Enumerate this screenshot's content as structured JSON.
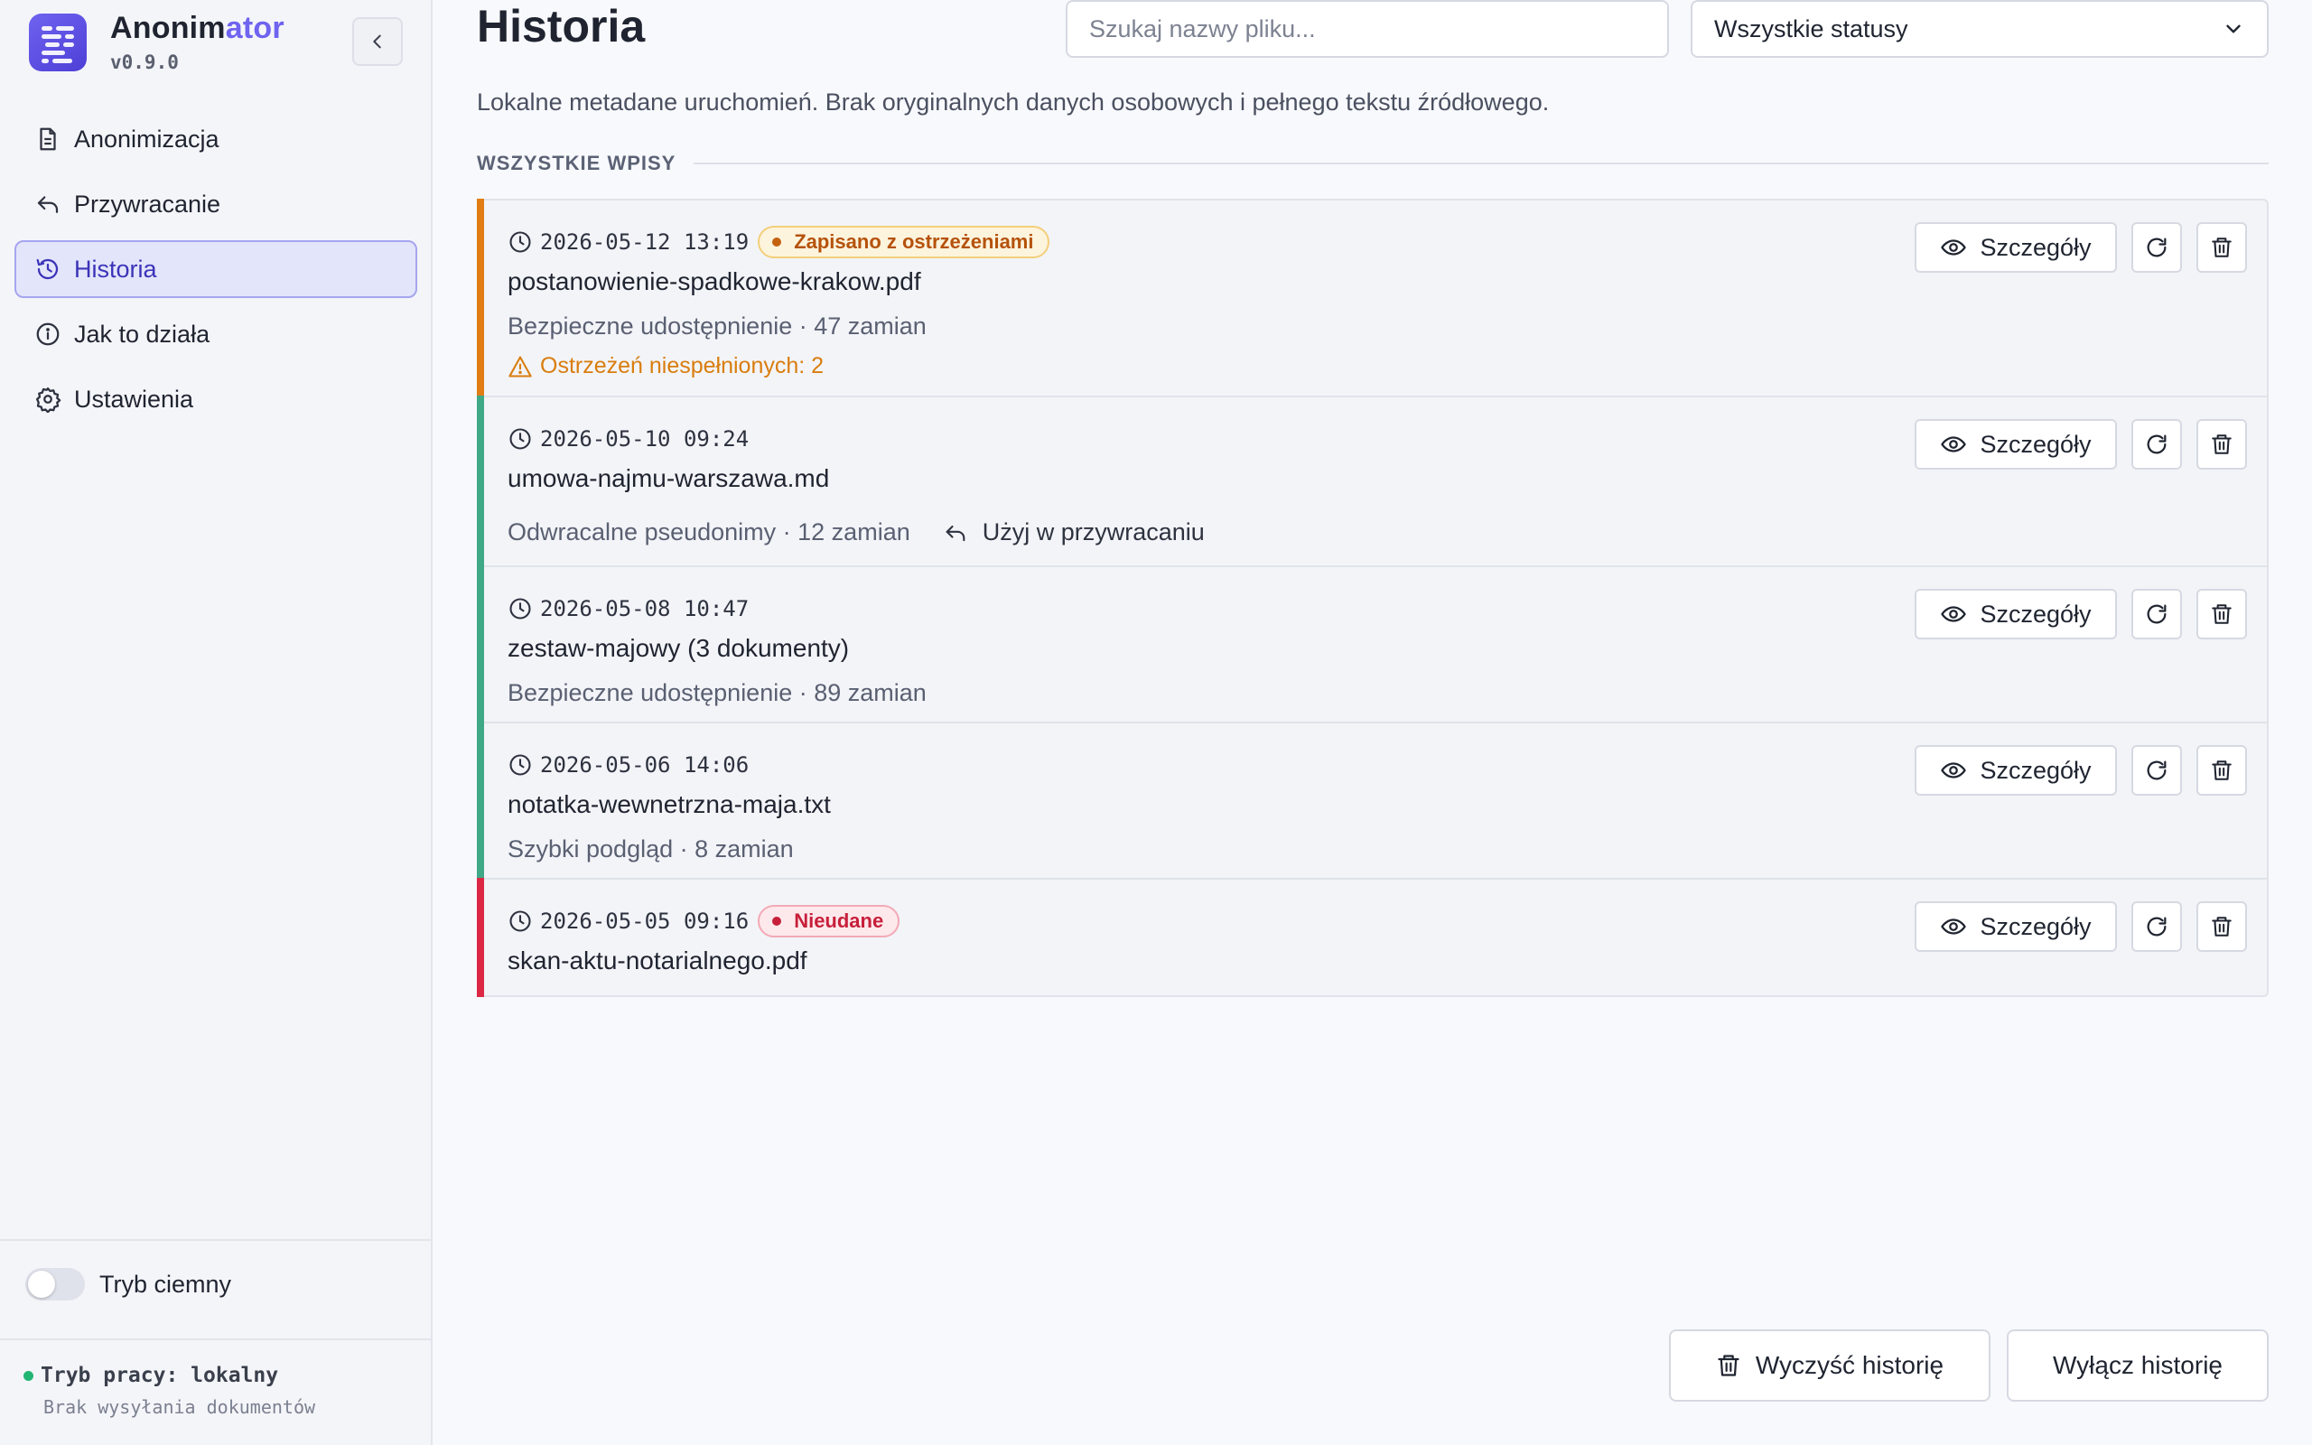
{
  "app": {
    "name_prefix": "Anonim",
    "name_suffix": "ator",
    "version": "v0.9.0",
    "accent_color": "#6f63f0"
  },
  "sidebar": {
    "items": [
      {
        "label": "Anonimizacja",
        "icon": "document-icon",
        "active": false
      },
      {
        "label": "Przywracanie",
        "icon": "undo-arrow-icon",
        "active": false
      },
      {
        "label": "Historia",
        "icon": "history-icon",
        "active": true
      },
      {
        "label": "Jak to działa",
        "icon": "info-icon",
        "active": false
      },
      {
        "label": "Ustawienia",
        "icon": "gear-icon",
        "active": false
      }
    ],
    "dark_mode_label": "Tryb ciemny",
    "dark_mode_on": false,
    "mode_title": "Tryb pracy: lokalny",
    "mode_subtitle": "Brak wysyłania dokumentów"
  },
  "header": {
    "title": "Historia",
    "search_placeholder": "Szukaj nazwy pliku...",
    "status_filter": "Wszystkie statusy",
    "subtitle": "Lokalne metadane uruchomień. Brak oryginalnych danych osobowych i pełnego tekstu źródłowego."
  },
  "section_label": "WSZYSTKIE WPISY",
  "actions": {
    "details_label": "Szczegóły"
  },
  "entries": [
    {
      "timestamp": "2026-05-12 13:19",
      "badge": "Zapisano z ostrzeżeniami",
      "badge_type": "warn",
      "filename": "postanowienie-spadkowe-krakow.pdf",
      "detail": "Bezpieczne udostępnienie · 47 zamian",
      "warning": "Ostrzeżeń niespełnionych: 2",
      "status_color": "#e07d14"
    },
    {
      "timestamp": "2026-05-10 09:24",
      "filename": "umowa-najmu-warszawa.md",
      "detail": "Odwracalne pseudonimy · 12 zamian",
      "restore_label": "Użyj w przywracaniu",
      "status_color": "#3fa887"
    },
    {
      "timestamp": "2026-05-08 10:47",
      "filename": "zestaw-majowy (3 dokumenty)",
      "detail": "Bezpieczne udostępnienie · 89 zamian",
      "status_color": "#3fa887"
    },
    {
      "timestamp": "2026-05-06 14:06",
      "filename": "notatka-wewnetrzna-maja.txt",
      "detail": "Szybki podgląd · 8 zamian",
      "status_color": "#3fa887"
    },
    {
      "timestamp": "2026-05-05 09:16",
      "badge": "Nieudane",
      "badge_type": "fail",
      "filename": "skan-aktu-notarialnego.pdf",
      "status_color": "#dc2845"
    }
  ],
  "footer": {
    "clear_label": "Wyczyść historię",
    "disable_label": "Wyłącz historię"
  }
}
